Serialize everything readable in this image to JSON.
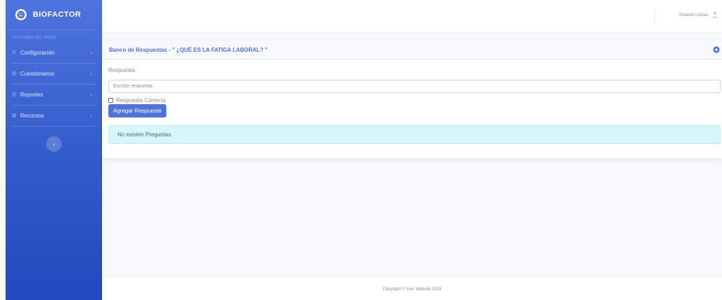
{
  "brand": {
    "name": "BIOFACTOR"
  },
  "sidebar": {
    "heading": "OPCIONES DEL MENÚ",
    "items": [
      {
        "label": "Configuración",
        "icon": "gear-icon"
      },
      {
        "label": "Cuestionarios",
        "icon": "table-icon"
      },
      {
        "label": "Reportes",
        "icon": "chart-icon"
      },
      {
        "label": "Recursos",
        "icon": "book-icon"
      }
    ],
    "toggle": "‹"
  },
  "topbar": {
    "user_name": "Roberto Lindao"
  },
  "card": {
    "title": "Banco de Respuestas - \" ¿QUÉ ES LA FATIGA LABORAL? \"",
    "field_label": "Respuesta",
    "input_placeholder": "Escribir respuesta",
    "checkbox_label": "Respuesta Correcta",
    "submit_label": "Agregar Respuesta",
    "alert_text": "No existen Preguntas"
  },
  "footer": {
    "text": "Copyright © Your Website 2019"
  },
  "colors": {
    "primary": "#4e73df",
    "alert_bg": "#d7f6f9"
  }
}
